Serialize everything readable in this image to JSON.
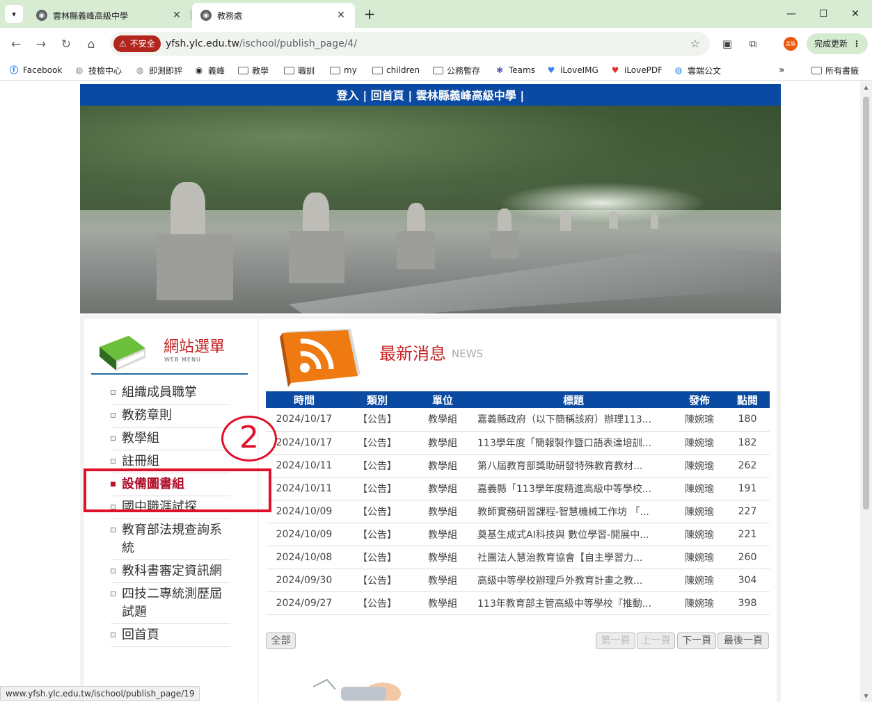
{
  "browser": {
    "tabs": [
      {
        "title": "雲林縣義峰高級中學",
        "active": false
      },
      {
        "title": "教務處",
        "active": true
      }
    ],
    "url_badge": "不安全",
    "url_host": "yfsh.ylc.edu.tw",
    "url_path": "/ischool/publish_page/4/",
    "profile_label": "孟瑜",
    "update_label": "完成更新",
    "bookmarks": [
      {
        "label": "Facebook",
        "icon": "facebook-icon"
      },
      {
        "label": "技檢中心",
        "icon": "site-icon"
      },
      {
        "label": "即測即評",
        "icon": "site-icon"
      },
      {
        "label": "義峰",
        "icon": "globe-icon"
      },
      {
        "label": "教學",
        "icon": "folder-icon"
      },
      {
        "label": "職訓",
        "icon": "folder-icon"
      },
      {
        "label": "my",
        "icon": "folder-icon"
      },
      {
        "label": "children",
        "icon": "folder-icon"
      },
      {
        "label": "公務暫存",
        "icon": "folder-icon"
      },
      {
        "label": "Teams",
        "icon": "teams-icon"
      },
      {
        "label": "iLoveIMG",
        "icon": "heart-icon"
      },
      {
        "label": "iLovePDF",
        "icon": "heart-icon"
      },
      {
        "label": "雲端公文",
        "icon": "site-icon"
      }
    ],
    "all_bookmarks": "所有書籤",
    "status_url": "www.yfsh.ylc.edu.tw/ischool/publish_page/19"
  },
  "site": {
    "topbar": "登入 | 回首頁 | 雲林縣義峰高級中學 |",
    "menu_title": "網站選單",
    "menu_sub": "WEB MENU",
    "menu_items": [
      {
        "label": "組織成員職掌",
        "active": false
      },
      {
        "label": "教務章則",
        "active": false
      },
      {
        "label": "教學組",
        "active": false
      },
      {
        "label": "註冊組",
        "active": false
      },
      {
        "label": "設備圖書組",
        "active": true
      },
      {
        "label": "國中職涯試探",
        "active": false
      },
      {
        "label": "教育部法規查詢系統",
        "active": false
      },
      {
        "label": "教科書審定資訊網",
        "active": false
      },
      {
        "label": "四技二專統測歷屆試題",
        "active": false
      },
      {
        "label": "回首頁",
        "active": false
      }
    ],
    "annotation_number": "2",
    "news_title": "最新消息",
    "news_en": "NEWS",
    "table_headers": [
      "時間",
      "類別",
      "單位",
      "標題",
      "發佈",
      "點閱"
    ],
    "rows": [
      [
        "2024/10/17",
        "【公告】",
        "教學組",
        "嘉義縣政府（以下簡稱該府）辦理113...",
        "陳婉瑜",
        "180"
      ],
      [
        "2024/10/17",
        "【公告】",
        "教學組",
        "113學年度「簡報製作暨口語表達培訓...",
        "陳婉瑜",
        "182"
      ],
      [
        "2024/10/11",
        "【公告】",
        "教學組",
        "第八屆教育部獎助研發特殊教育教材...",
        "陳婉瑜",
        "262"
      ],
      [
        "2024/10/11",
        "【公告】",
        "教學組",
        "嘉義縣「113學年度精進高級中等學校...",
        "陳婉瑜",
        "191"
      ],
      [
        "2024/10/09",
        "【公告】",
        "教學組",
        "教師實務研習課程-智慧機械工作坊 「...",
        "陳婉瑜",
        "227"
      ],
      [
        "2024/10/09",
        "【公告】",
        "教學組",
        "奠基生成式AI科技與 數位學習-開展中...",
        "陳婉瑜",
        "221"
      ],
      [
        "2024/10/08",
        "【公告】",
        "教學組",
        "社團法人慧治教育協會【自主學習力...",
        "陳婉瑜",
        "260"
      ],
      [
        "2024/09/30",
        "【公告】",
        "教學組",
        "高級中等學校辦理戶外教育計畫之教...",
        "陳婉瑜",
        "304"
      ],
      [
        "2024/09/27",
        "【公告】",
        "教學組",
        "113年教育部主管高級中等學校『推動...",
        "陳婉瑜",
        "398"
      ]
    ],
    "pager": {
      "all": "全部",
      "first": "第一頁",
      "prev": "上一頁",
      "next": "下一頁",
      "last": "最後一頁"
    }
  },
  "colors": {
    "topbar_blue": "#0b4aa2",
    "highlight_red": "#e0102a",
    "menu_active": "#b00d2a",
    "title_red": "#c41f1f"
  }
}
